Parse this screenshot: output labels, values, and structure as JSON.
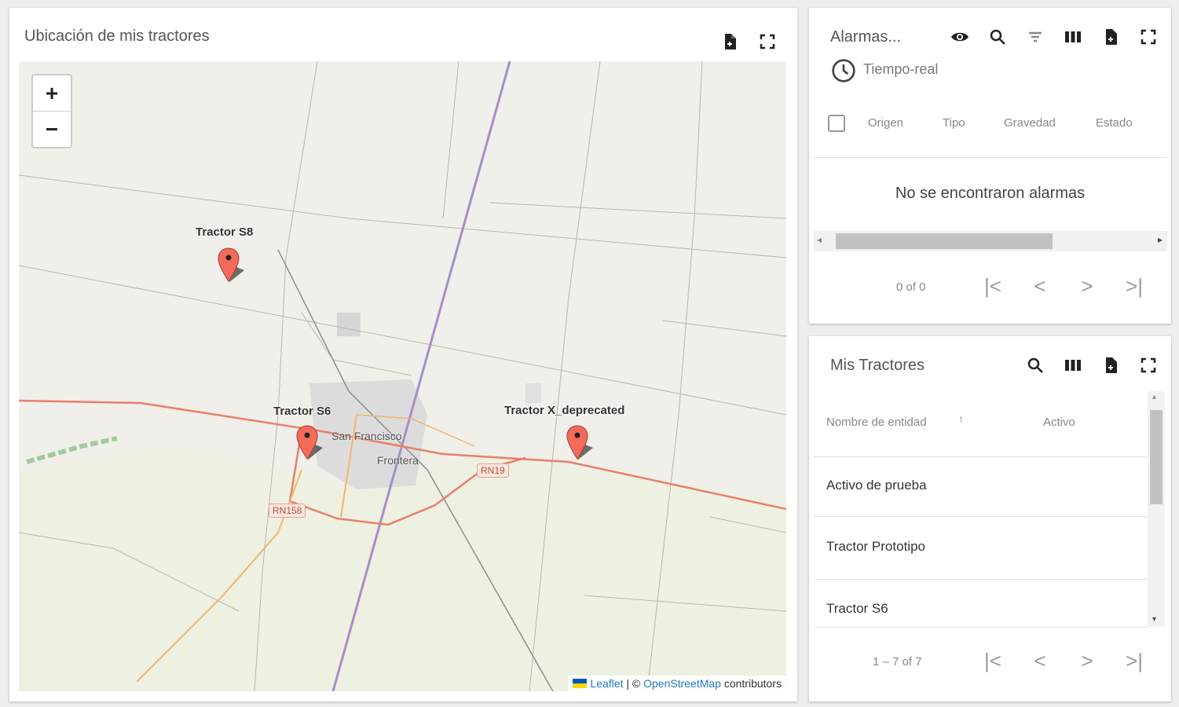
{
  "map_widget": {
    "title": "Ubicación de mis tractores",
    "zoom_in_label": "+",
    "zoom_out_label": "−",
    "markers": [
      {
        "label": "Tractor S8"
      },
      {
        "label": "Tractor S6"
      },
      {
        "label": "Tractor X_deprecated"
      }
    ],
    "places": [
      "San Francisco",
      "Frontera"
    ],
    "road_shields": [
      "RN158",
      "RN19"
    ],
    "attribution": {
      "leaflet": "Leaflet",
      "separator": " | © ",
      "osm": "OpenStreetMap",
      "suffix": " contributors"
    },
    "icons": [
      "file-export-icon",
      "fullscreen-icon"
    ]
  },
  "alarms_widget": {
    "title": "Alarmas...",
    "time_window": "Tiempo-real",
    "columns": [
      "Origen",
      "Tipo",
      "Gravedad",
      "Estado"
    ],
    "empty_message": "No se encontraron alarmas",
    "pagination": "0 of 0",
    "icons": [
      "eye-icon",
      "search-icon",
      "filter-icon",
      "columns-icon",
      "file-export-icon",
      "fullscreen-icon"
    ]
  },
  "tractors_widget": {
    "title": "Mis Tractores",
    "columns": [
      "Nombre de entidad",
      "Activo"
    ],
    "sort_indicator": "↑",
    "rows": [
      "Activo de prueba",
      "Tractor Prototipo",
      "Tractor S6"
    ],
    "pagination": "1 – 7 of 7",
    "icons": [
      "search-icon",
      "columns-icon",
      "file-export-icon",
      "fullscreen-icon"
    ]
  },
  "colors": {
    "marker": "#f26b5b",
    "road_primary": "#e8806a",
    "road_secondary": "#f0b56b",
    "railway": "#a58fc4",
    "map_bg": "#f1efea"
  }
}
